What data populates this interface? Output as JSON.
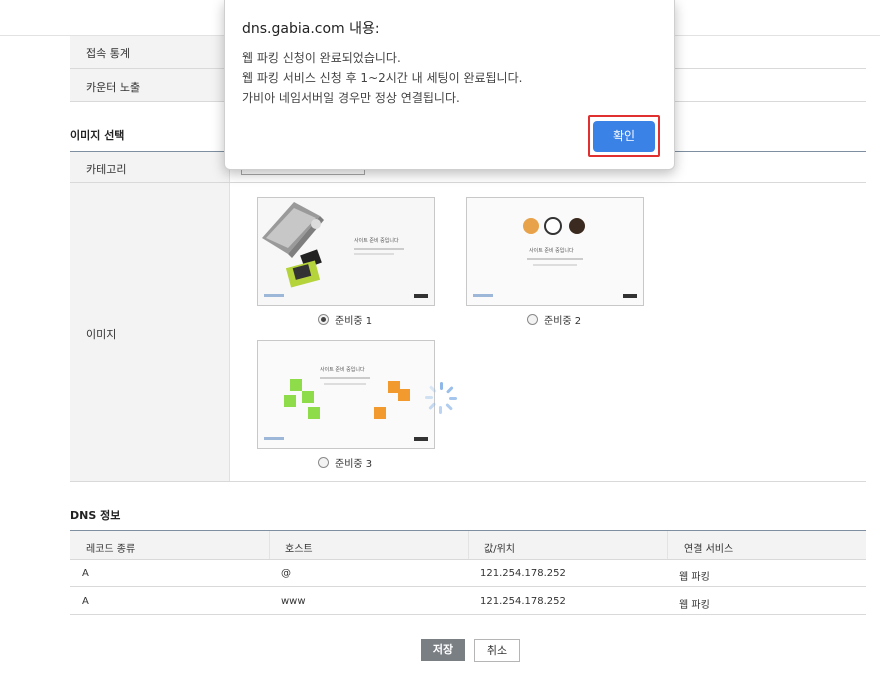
{
  "dialog": {
    "title": "dns.gabia.com 내용:",
    "lines": [
      "웹 파킹 신청이 완료되었습니다.",
      "웹 파킹 서비스 신청 후 1~2시간 내 세팅이 완료됩니다.",
      "가비아 네임서버일 경우만 정상 연결됩니다."
    ],
    "ok_label": "확인",
    "ok_color": "#3b82e6",
    "highlight_color": "#e03030"
  },
  "settings": {
    "access_stats_label": "접속 통계",
    "counter_label": "카운터 노출"
  },
  "image_section": {
    "title": "이미지 선택",
    "category_label": "카테고리",
    "category_value": "준비중",
    "image_label": "이미지",
    "options": [
      {
        "label": "준비중 1",
        "checked": true,
        "thumb_heading": "사이트 준비 중입니다"
      },
      {
        "label": "준비중 2",
        "checked": false,
        "thumb_heading": "사이트 준비 중입니다"
      },
      {
        "label": "준비중 3",
        "checked": false,
        "thumb_heading": "사이트 준비 중입니다"
      }
    ]
  },
  "dns": {
    "title": "DNS 정보",
    "columns": [
      "레코드 종류",
      "호스트",
      "값/위치",
      "연결 서비스"
    ],
    "rows": [
      [
        "A",
        "@",
        "121.254.178.252",
        "웹 파킹"
      ],
      [
        "A",
        "www",
        "121.254.178.252",
        "웹 파킹"
      ]
    ]
  },
  "buttons": {
    "save_label": "저장",
    "cancel_label": "취소"
  }
}
